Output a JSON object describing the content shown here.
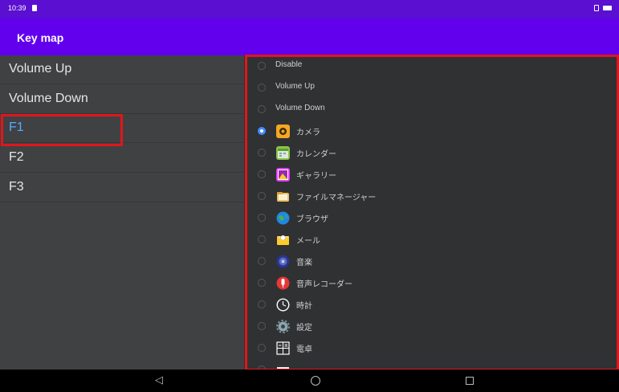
{
  "status_bar": {
    "time": "10:39"
  },
  "app_bar": {
    "title": "Key map"
  },
  "keys": [
    {
      "label": "Volume Up",
      "selected": false
    },
    {
      "label": "Volume Down",
      "selected": false
    },
    {
      "label": "F1",
      "selected": true
    },
    {
      "label": "F2",
      "selected": false
    },
    {
      "label": "F3",
      "selected": false
    }
  ],
  "options": [
    {
      "label": "Disable",
      "checked": false,
      "icon": null
    },
    {
      "label": "Volume Up",
      "checked": false,
      "icon": null
    },
    {
      "label": "Volume Down",
      "checked": false,
      "icon": null
    },
    {
      "label": "カメラ",
      "checked": true,
      "icon": "camera-icon"
    },
    {
      "label": "カレンダー",
      "checked": false,
      "icon": "calendar-icon"
    },
    {
      "label": "ギャラリー",
      "checked": false,
      "icon": "gallery-icon"
    },
    {
      "label": "ファイルマネージャー",
      "checked": false,
      "icon": "file-manager-icon"
    },
    {
      "label": "ブラウザ",
      "checked": false,
      "icon": "browser-icon"
    },
    {
      "label": "メール",
      "checked": false,
      "icon": "mail-icon"
    },
    {
      "label": "音楽",
      "checked": false,
      "icon": "music-icon"
    },
    {
      "label": "音声レコーダー",
      "checked": false,
      "icon": "voice-recorder-icon"
    },
    {
      "label": "時計",
      "checked": false,
      "icon": "clock-icon"
    },
    {
      "label": "設定",
      "checked": false,
      "icon": "settings-icon"
    },
    {
      "label": "電卓",
      "checked": false,
      "icon": "calculator-icon"
    },
    {
      "label": "",
      "checked": false,
      "icon": "video-player-icon"
    }
  ],
  "nav": {
    "back": "back-icon",
    "home": "home-icon",
    "recents": "recents-icon"
  },
  "colors": {
    "status_bar": "#5a0fd1",
    "app_bar": "#6200ee",
    "selected_text": "#5aa8ff",
    "radio_checked": "#3f8cff",
    "highlight_border": "#e0161c"
  }
}
